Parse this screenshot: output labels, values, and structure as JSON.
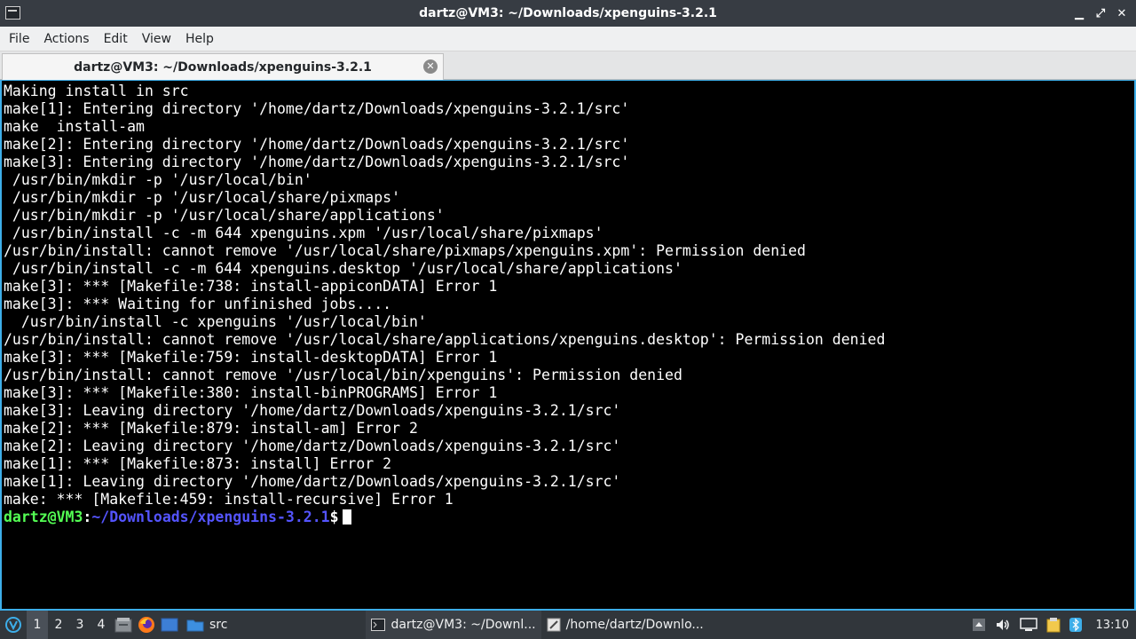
{
  "window": {
    "title": "dartz@VM3: ~/Downloads/xpenguins-3.2.1",
    "controls": {
      "minimize": "▁",
      "restore": "⤢",
      "close": "✕"
    }
  },
  "menubar": {
    "items": [
      "File",
      "Actions",
      "Edit",
      "View",
      "Help"
    ]
  },
  "tab": {
    "title": "dartz@VM3: ~/Downloads/xpenguins-3.2.1"
  },
  "terminal": {
    "lines": [
      "Making install in src",
      "make[1]: Entering directory '/home/dartz/Downloads/xpenguins-3.2.1/src'",
      "make  install-am",
      "make[2]: Entering directory '/home/dartz/Downloads/xpenguins-3.2.1/src'",
      "make[3]: Entering directory '/home/dartz/Downloads/xpenguins-3.2.1/src'",
      " /usr/bin/mkdir -p '/usr/local/bin'",
      " /usr/bin/mkdir -p '/usr/local/share/pixmaps'",
      " /usr/bin/mkdir -p '/usr/local/share/applications'",
      " /usr/bin/install -c -m 644 xpenguins.xpm '/usr/local/share/pixmaps'",
      "/usr/bin/install: cannot remove '/usr/local/share/pixmaps/xpenguins.xpm': Permission denied",
      " /usr/bin/install -c -m 644 xpenguins.desktop '/usr/local/share/applications'",
      "make[3]: *** [Makefile:738: install-appiconDATA] Error 1",
      "make[3]: *** Waiting for unfinished jobs....",
      "  /usr/bin/install -c xpenguins '/usr/local/bin'",
      "/usr/bin/install: cannot remove '/usr/local/share/applications/xpenguins.desktop': Permission denied",
      "make[3]: *** [Makefile:759: install-desktopDATA] Error 1",
      "/usr/bin/install: cannot remove '/usr/local/bin/xpenguins': Permission denied",
      "make[3]: *** [Makefile:380: install-binPROGRAMS] Error 1",
      "make[3]: Leaving directory '/home/dartz/Downloads/xpenguins-3.2.1/src'",
      "make[2]: *** [Makefile:879: install-am] Error 2",
      "make[2]: Leaving directory '/home/dartz/Downloads/xpenguins-3.2.1/src'",
      "make[1]: *** [Makefile:873: install] Error 2",
      "make[1]: Leaving directory '/home/dartz/Downloads/xpenguins-3.2.1/src'",
      "make: *** [Makefile:459: install-recursive] Error 1"
    ],
    "prompt": {
      "user": "dartz@VM3",
      "colon": ":",
      "path": "~/Downloads/xpenguins-3.2.1",
      "symbol": "$"
    },
    "colors": {
      "background": "#000000",
      "text": "#ffffff",
      "user": "#54ff54",
      "path": "#5454ff",
      "border": "#3daee9"
    }
  },
  "taskbar": {
    "start_icon": "lxqt-start-icon",
    "desktops": [
      "1",
      "2",
      "3",
      "4"
    ],
    "active_desktop": "1",
    "quicklaunch": [
      {
        "icon": "file-manager-icon"
      },
      {
        "icon": "firefox-icon"
      },
      {
        "icon": "show-desktop-icon"
      }
    ],
    "folder_task": {
      "icon": "folder-icon",
      "label": "src"
    },
    "tasks": [
      {
        "icon": "terminal-icon",
        "label": "dartz@VM3: ~/Downl...",
        "active": true
      },
      {
        "icon": "text-editor-icon",
        "label": "/home/dartz/Downlo...",
        "active": false
      }
    ],
    "tray": [
      {
        "icon": "tray-up-arrow-icon"
      },
      {
        "icon": "volume-icon"
      },
      {
        "icon": "screen-icon"
      },
      {
        "icon": "clipboard-icon"
      },
      {
        "icon": "bluetooth-icon"
      }
    ],
    "clock": "13:10"
  }
}
